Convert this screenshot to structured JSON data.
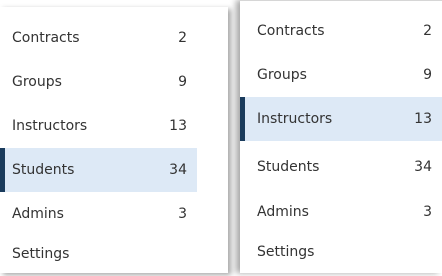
{
  "left_menu": {
    "items": [
      {
        "label": "Contracts",
        "count": "2"
      },
      {
        "label": "Groups",
        "count": "9"
      },
      {
        "label": "Instructors",
        "count": "13"
      },
      {
        "label": "Students",
        "count": "34"
      },
      {
        "label": "Admins",
        "count": "3"
      },
      {
        "label": "Settings",
        "count": ""
      }
    ],
    "active_item": "Students"
  },
  "right_menu": {
    "items": [
      {
        "label": "Contracts",
        "count": "2"
      },
      {
        "label": "Groups",
        "count": "9"
      },
      {
        "label": "Instructors",
        "count": "13"
      },
      {
        "label": "Students",
        "count": "34"
      },
      {
        "label": "Admins",
        "count": "3"
      },
      {
        "label": "Settings",
        "count": ""
      }
    ],
    "active_item": "Instructors"
  },
  "colors": {
    "active_background": "#dde9f6",
    "active_indicator": "#1a3b5c",
    "text": "#333333"
  }
}
